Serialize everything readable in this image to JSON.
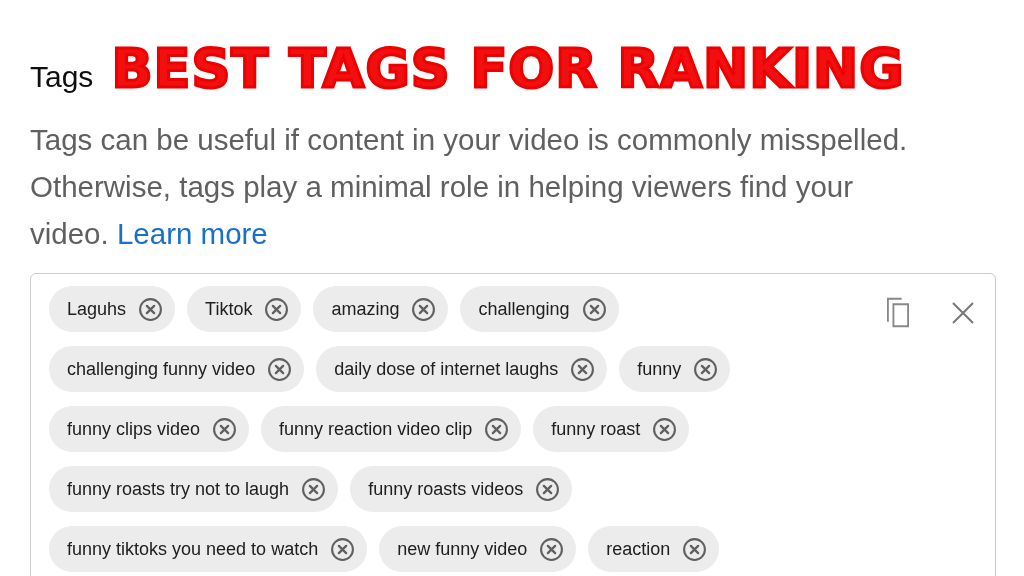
{
  "heading": "Tags",
  "headline": "BEST TAGS FOR RANKING",
  "description": {
    "text": "Tags can be useful if content in your video is commonly misspelled. Otherwise, tags play a minimal role in helping viewers find your video.",
    "link": "Learn more"
  },
  "tags": [
    {
      "label": "Laguhs"
    },
    {
      "label": "Tiktok"
    },
    {
      "label": "amazing"
    },
    {
      "label": "challenging"
    },
    {
      "label": "challenging funny video"
    },
    {
      "label": "daily dose of internet laughs"
    },
    {
      "label": "funny"
    },
    {
      "label": "funny clips video"
    },
    {
      "label": "funny reaction video clip"
    },
    {
      "label": "funny roast"
    },
    {
      "label": "funny roasts try not to laugh"
    },
    {
      "label": "funny roasts videos"
    },
    {
      "label": "funny tiktoks you need to watch"
    },
    {
      "label": "new funny video"
    },
    {
      "label": "reaction"
    }
  ]
}
